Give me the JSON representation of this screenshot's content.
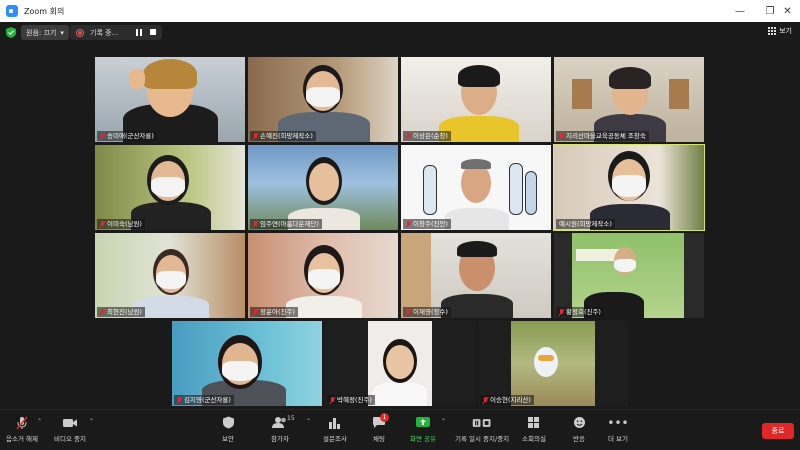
{
  "window": {
    "title": "Zoom 회의",
    "minimize": "—",
    "maximize": "❐",
    "close": "✕"
  },
  "topbar": {
    "view_label": "원음: 끄기",
    "recording_label": "기록 중...",
    "view_button": "보기",
    "security_icon": "shield-check-icon"
  },
  "participants": [
    {
      "name": "송미애(군산자룡)"
    },
    {
      "name": "손혜진(희망제작소)"
    },
    {
      "name": "이상은(순창)"
    },
    {
      "name": "지리산마을교육공동체 조창숙"
    },
    {
      "name": "이미숙(남원)"
    },
    {
      "name": "임주연(아름다운재단)"
    },
    {
      "name": "이창주(진안)"
    },
    {
      "name": "예시원(희망제작소)"
    },
    {
      "name": "최현진(남원)"
    },
    {
      "name": "정윤아(진주)"
    },
    {
      "name": "이재영(장수)"
    },
    {
      "name": "황정호(진주)"
    },
    {
      "name": "김지영(군산자룡)"
    },
    {
      "name": "박혜정(진주)"
    },
    {
      "name": "이승현(지리산)"
    }
  ],
  "toolbar": {
    "mute_label": "음소거 해제",
    "video_label": "비디오 중지",
    "security_label": "보안",
    "participants_label": "참가자",
    "participants_count": "15",
    "polls_label": "설문조사",
    "chat_label": "채팅",
    "chat_badge": "1",
    "share_label": "화면 공유",
    "record_label": "기록 일시 중지/중지",
    "breakout_label": "소회의실",
    "reactions_label": "반응",
    "more_label": "더 보기",
    "end_label": "종료"
  },
  "colors": {
    "accent_active": "#d4e66b",
    "end_red": "#e02828",
    "share_green": "#22b33a",
    "zoom_blue": "#2d8cff"
  }
}
